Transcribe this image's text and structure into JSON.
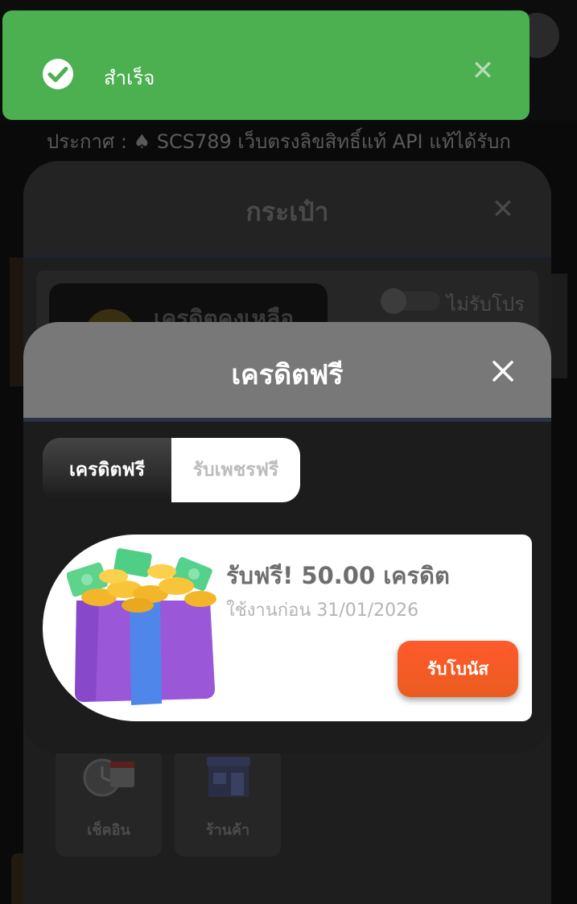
{
  "background": {
    "announcement": "ประกาศ : ♠ SCS789 เว็บตรงลิขสิทธิ์แท้ API แท้ได้รับก",
    "wallet": {
      "title": "กระเป๋า",
      "credit_label": "เครดิตคงเหลือ",
      "promo_toggle_label": "ไม่รับโปร",
      "promo_toggle_on": false
    },
    "menu": [
      {
        "label": "เช็คอิน",
        "icon": "calendar-clock-icon"
      },
      {
        "label": "ร้านค้า",
        "icon": "shop-icon"
      }
    ]
  },
  "toast": {
    "message": "สำเร็จ",
    "icon": "check-circle-icon",
    "color": "#4caf50"
  },
  "free_credit_modal": {
    "title": "เครดิตฟรี",
    "tabs": [
      {
        "label": "เครดิตฟรี",
        "active": true
      },
      {
        "label": "รับเพชรฟรี",
        "active": false
      }
    ],
    "bonus": {
      "title": "รับฟรี! 50.00 เครดิต",
      "expiry": "ใช้งานก่อน 31/01/2026",
      "button_label": "รับโบนัส",
      "icon": "gift-box-icon",
      "button_color": "#f4521e"
    }
  }
}
